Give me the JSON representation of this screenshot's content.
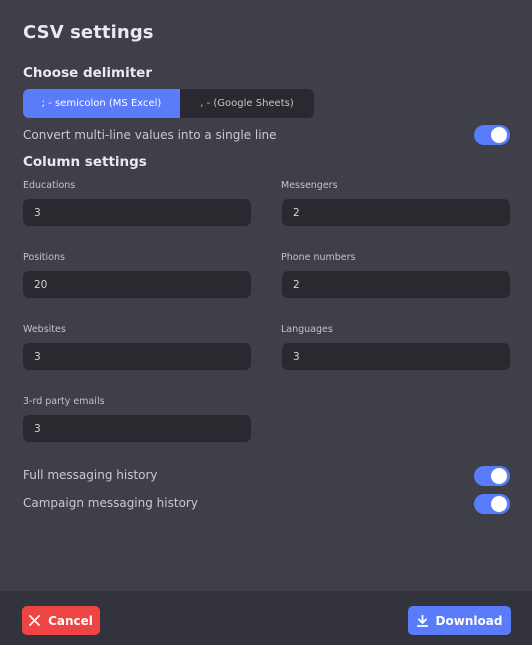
{
  "dialog": {
    "title": "CSV settings"
  },
  "delimiter": {
    "heading": "Choose delimiter",
    "options": [
      {
        "label": "; - semicolon (MS Excel)",
        "selected": true
      },
      {
        "label": ", - (Google Sheets)",
        "selected": false
      }
    ]
  },
  "convert_multiline": {
    "label": "Convert multi-line values into a single line",
    "enabled": true
  },
  "column_settings": {
    "heading": "Column settings",
    "fields": [
      {
        "label": "Educations",
        "value": "3"
      },
      {
        "label": "Messengers",
        "value": "2"
      },
      {
        "label": "Positions",
        "value": "20"
      },
      {
        "label": "Phone numbers",
        "value": "2"
      },
      {
        "label": "Websites",
        "value": "3"
      },
      {
        "label": "Languages",
        "value": "3"
      },
      {
        "label": "3-rd party emails",
        "value": "3"
      }
    ]
  },
  "toggles": [
    {
      "label": "Full messaging history",
      "enabled": true
    },
    {
      "label": "Campaign messaging history",
      "enabled": true
    }
  ],
  "footer": {
    "cancel_label": "Cancel",
    "cancel_icon": "close-icon",
    "download_label": "Download",
    "download_icon": "download-icon"
  },
  "colors": {
    "accent": "#5b7cfa",
    "danger": "#ef4444",
    "background": "#3f3f4a",
    "input_background": "#29292f",
    "footer_background": "#33333d"
  }
}
